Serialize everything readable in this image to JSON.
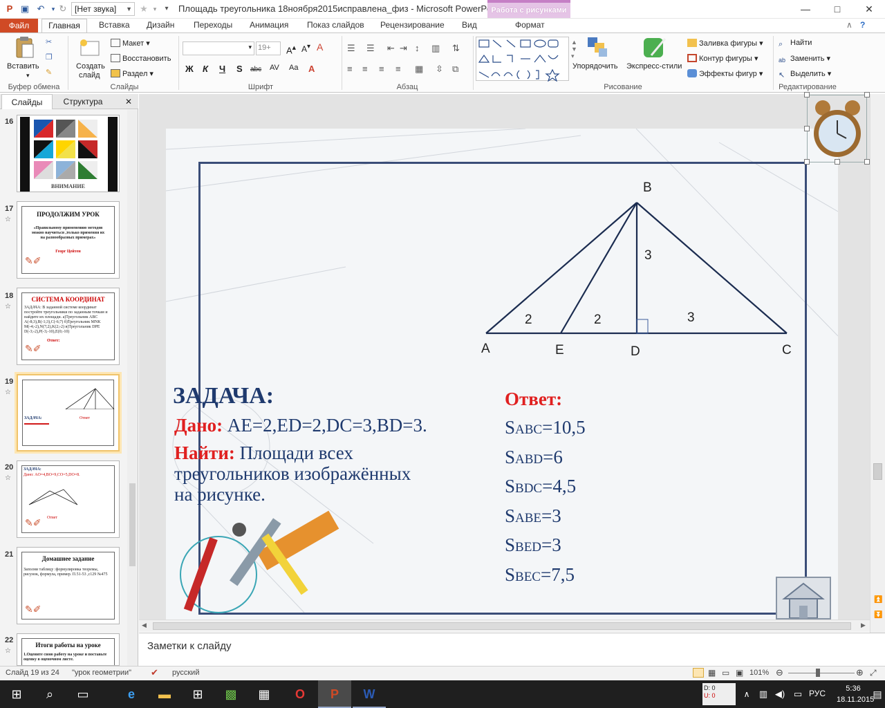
{
  "titlebar": {
    "sound_select": "[Нет звука]",
    "doc_title": "Площадь треугольника 18ноября2015исправлена_физ  -  Microsoft PowerPoint",
    "context_tab": "Работа с рисунками",
    "minimize": "—",
    "maximize": "□",
    "close": "✕"
  },
  "tabs": [
    "Файл",
    "Главная",
    "Вставка",
    "Дизайн",
    "Переходы",
    "Анимация",
    "Показ слайдов",
    "Рецензирование",
    "Вид",
    "Формат"
  ],
  "ribbon": {
    "clipboard": {
      "paste": "Вставить",
      "label": "Буфер обмена"
    },
    "slides": {
      "new_slide": "Создать",
      "new_slide2": "слайд",
      "layout": "Макет",
      "reset": "Восстановить",
      "section": "Раздел",
      "label": "Слайды"
    },
    "font": {
      "size": "19+",
      "bold": "Ж",
      "italic": "К",
      "underline": "Ч",
      "strike": "S",
      "spacing": "abc",
      "label": "Шрифт"
    },
    "paragraph": {
      "label": "Абзац"
    },
    "drawing": {
      "arrange": "Упорядочить",
      "quick_styles": "Экспресс-стили",
      "fill": "Заливка фигуры",
      "outline": "Контур фигуры",
      "effects": "Эффекты фигур",
      "label": "Рисование"
    },
    "editing": {
      "find": "Найти",
      "replace": "Заменить",
      "select": "Выделить",
      "label": "Редактирование"
    }
  },
  "panel": {
    "tab_slides": "Слайды",
    "tab_outline": "Структура",
    "close": "✕",
    "thumbs": [
      {
        "num": "16",
        "caption": "ВНИМАНИЕ"
      },
      {
        "num": "17",
        "title": "ПРОДОЛЖИМ УРОК",
        "text": "«Правильному применению методов можно научиться ,только применяя их на разнообразных примерах»",
        "author": "Георг Цейтен"
      },
      {
        "num": "18",
        "title": "СИСТЕМА КООРДИНАТ",
        "text": "ЗАДАЧА: В заданной системе координат постройте треугольники по заданным точкам и найдите их площади. а)Треугольник ABC A(-8;3),B(-1;3),C(-6;7) б)Треугольник MNK M(-4;-2),N(7;2),K(2;-2) в)Треугольник DPE D(-3;-2),P(-3;-10),E(0;-10)",
        "answer": "Ответ:"
      },
      {
        "num": "19",
        "title": "ЗАДАЧА:",
        "answer": "Ответ"
      },
      {
        "num": "20",
        "title": "ЗАДАЧА:",
        "text": "Дано: AO=4,BO=9,CO=5,DO=8.",
        "answer": "Ответ"
      },
      {
        "num": "21",
        "title": "Домашнее задание",
        "text": "Заполни таблицу :формулировка теоремы, рисунок, формула, пример. П.51-53 ,с129 №475"
      },
      {
        "num": "22",
        "title": "Итоги работы на уроке",
        "text": "1.Оцените свою работу на уроке и поставьте оценку в оценочном листе."
      }
    ]
  },
  "slide": {
    "figure": {
      "A": "A",
      "B": "B",
      "C": "C",
      "D": "D",
      "E": "E",
      "ae": "2",
      "ed": "2",
      "dc": "3",
      "bd": "3"
    },
    "task_title": "ЗАДАЧА:",
    "given_label": "Дано:",
    "given_text": " AE=2,ED=2,DC=3,BD=3.",
    "find_label": "Найти:",
    "find_text": " Площади всех",
    "find_text2": "треугольников изображённых",
    "find_text3": "на рисунке.",
    "answer_label": "Ответ:",
    "answers": [
      {
        "s": "S",
        "sub": "ABC",
        "val": "=10,5"
      },
      {
        "s": "S",
        "sub": "ABD",
        "val": "=6"
      },
      {
        "s": "S",
        "sub": "BDC",
        "val": "=4,5"
      },
      {
        "s": "S",
        "sub": "ABE",
        "val": "=3"
      },
      {
        "s": "S",
        "sub": "BED",
        "val": "=3"
      },
      {
        "s": "S",
        "sub": "BEC",
        "val": "=7,5"
      }
    ]
  },
  "notes": {
    "placeholder": "Заметки к слайду"
  },
  "status": {
    "slide": "Слайд 19 из 24",
    "theme": "\"урок геометрии\"",
    "lang": "русский",
    "zoom": "101%"
  },
  "taskbar": {
    "lang": "РУС",
    "time": "5:36",
    "date": "18.11.2015",
    "disk_d": "D: 0",
    "disk_u": "U: 0"
  },
  "colors": {
    "accent": "#d04a25",
    "frame": "#3a4d78",
    "title_blue": "#1f3a6e",
    "red": "#e02020"
  }
}
